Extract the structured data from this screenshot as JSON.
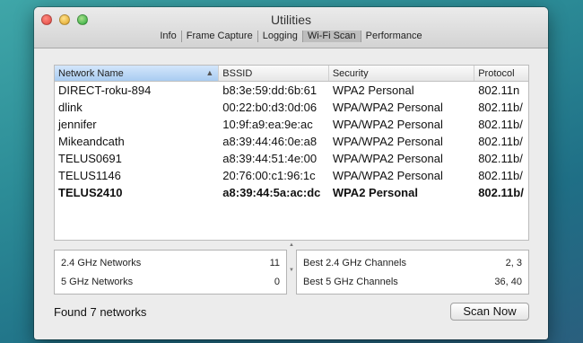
{
  "window": {
    "title": "Utilities",
    "tabs": [
      {
        "label": "Info"
      },
      {
        "label": "Frame Capture"
      },
      {
        "label": "Logging"
      },
      {
        "label": "Wi-Fi Scan"
      },
      {
        "label": "Performance"
      }
    ],
    "active_tab": "Wi-Fi Scan"
  },
  "table": {
    "columns": [
      "Network Name",
      "BSSID",
      "Security",
      "Protocol"
    ],
    "sorted_column": "Network Name",
    "rows": [
      {
        "name": "DIRECT-roku-894",
        "bssid": "b8:3e:59:dd:6b:61",
        "security": "WPA2 Personal",
        "protocol": "802.11n"
      },
      {
        "name": "dlink",
        "bssid": "00:22:b0:d3:0d:06",
        "security": "WPA/WPA2 Personal",
        "protocol": "802.11b/"
      },
      {
        "name": "jennifer",
        "bssid": "10:9f:a9:ea:9e:ac",
        "security": "WPA/WPA2 Personal",
        "protocol": "802.11b/"
      },
      {
        "name": "Mikeandcath",
        "bssid": "a8:39:44:46:0e:a8",
        "security": "WPA/WPA2 Personal",
        "protocol": "802.11b/"
      },
      {
        "name": "TELUS0691",
        "bssid": "a8:39:44:51:4e:00",
        "security": "WPA/WPA2 Personal",
        "protocol": "802.11b/"
      },
      {
        "name": "TELUS1146",
        "bssid": "20:76:00:c1:96:1c",
        "security": "WPA/WPA2 Personal",
        "protocol": "802.11b/"
      },
      {
        "name": "TELUS2410",
        "bssid": "a8:39:44:5a:ac:dc",
        "security": "WPA2 Personal",
        "protocol": "802.11b/"
      }
    ]
  },
  "summary": {
    "left": [
      {
        "label": "2.4 GHz Networks",
        "value": "11"
      },
      {
        "label": "5 GHz Networks",
        "value": "0"
      }
    ],
    "right": [
      {
        "label": "Best 2.4 GHz Channels",
        "value": "2, 3"
      },
      {
        "label": "Best 5 GHz Channels",
        "value": "36, 40"
      }
    ]
  },
  "footer": {
    "status": "Found 7 networks",
    "scan_button": "Scan Now"
  },
  "colors": {
    "window_bg": "#ececec",
    "sorted_header": "#a9ccf1",
    "close": "#e0443e",
    "minimize": "#dea123",
    "maximize": "#27a93a"
  }
}
